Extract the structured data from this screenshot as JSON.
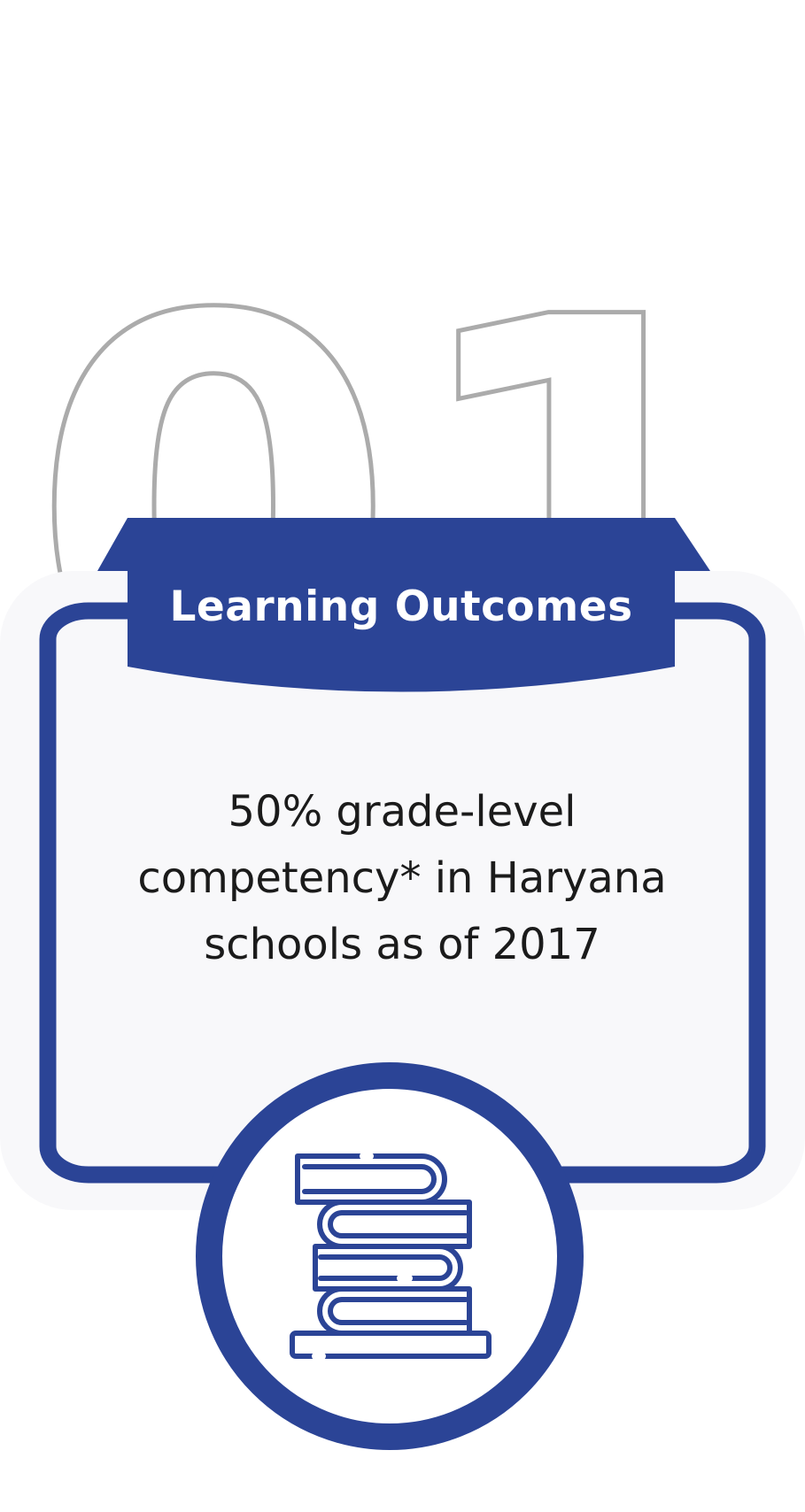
{
  "card": {
    "number": "01",
    "title": "Learning Outcomes",
    "description_lines": [
      "50% grade-level",
      "competency* in Haryana",
      "schools as of 2017"
    ],
    "icon": "books-stack-icon"
  },
  "colors": {
    "accent": "#2b4496",
    "panel": "#f8f8fa",
    "number_outline": "#ababab",
    "text": "#1b1b1b",
    "banner_text": "#ffffff"
  }
}
